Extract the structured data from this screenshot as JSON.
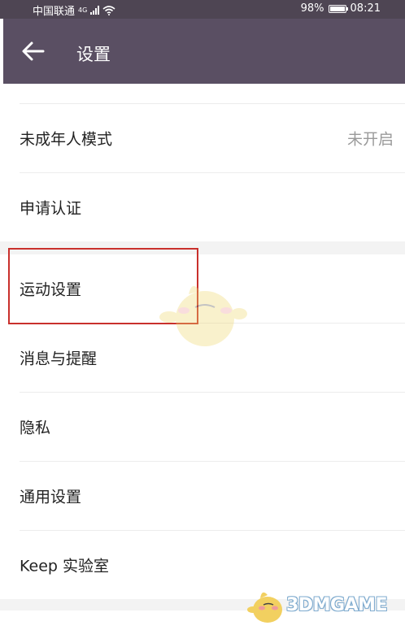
{
  "status_bar": {
    "carrier": "中国联通",
    "network": "4G",
    "battery_percent": "98%",
    "battery_level": 0.98,
    "time": "08:21"
  },
  "app_bar": {
    "title": "设置",
    "back_icon": "arrow-left-icon"
  },
  "settings": {
    "items": [
      {
        "label": "未成年人模式",
        "value": "未开启"
      },
      {
        "label": "申请认证"
      },
      {
        "label": "运动设置"
      },
      {
        "label": "消息与提醒"
      },
      {
        "label": "隐私"
      },
      {
        "label": "通用设置"
      },
      {
        "label": "Keep 实验室"
      }
    ]
  },
  "watermark": {
    "text": "3DMGAME"
  },
  "colors": {
    "app_bar": "#5a4f63",
    "status_bar": "#4e4553",
    "highlight": "#c9302c",
    "secondary_text": "#9a9a9a"
  }
}
